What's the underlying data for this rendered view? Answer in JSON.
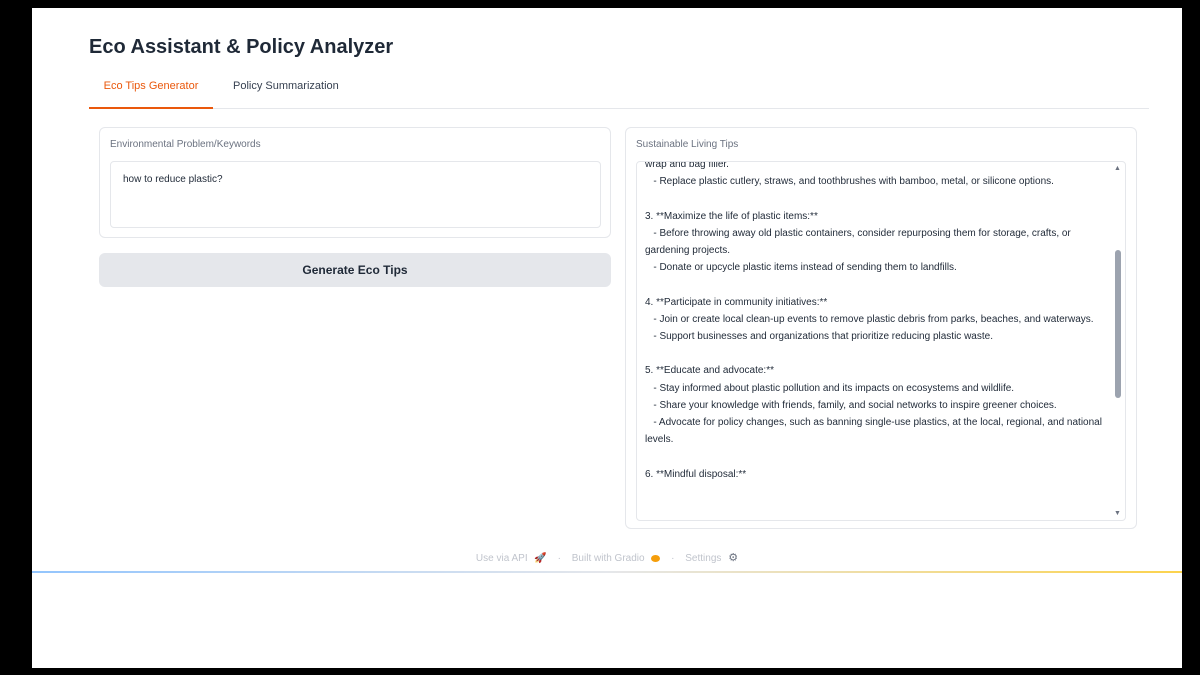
{
  "app": {
    "title": "Eco Assistant & Policy Analyzer"
  },
  "tabs": [
    {
      "label": "Eco Tips Generator",
      "active": true
    },
    {
      "label": "Policy Summarization",
      "active": false
    }
  ],
  "input_panel": {
    "label": "Environmental Problem/Keywords",
    "value": "how to reduce plastic?"
  },
  "generate_button": {
    "label": "Generate Eco Tips"
  },
  "output_panel": {
    "label": "Sustainable Living Tips",
    "text": "wrap and bag filler.\n   - Replace plastic cutlery, straws, and toothbrushes with bamboo, metal, or silicone options.\n\n3. **Maximize the life of plastic items:**\n   - Before throwing away old plastic containers, consider repurposing them for storage, crafts, or gardening projects.\n   - Donate or upcycle plastic items instead of sending them to landfills.\n\n4. **Participate in community initiatives:**\n   - Join or create local clean-up events to remove plastic debris from parks, beaches, and waterways.\n   - Support businesses and organizations that prioritize reducing plastic waste.\n\n5. **Educate and advocate:**\n   - Stay informed about plastic pollution and its impacts on ecosystems and wildlife.\n   - Share your knowledge with friends, family, and social networks to inspire greener choices.\n   - Advocate for policy changes, such as banning single-use plastics, at the local, regional, and national levels.\n\n6. **Mindful disposal:**"
  },
  "footer": {
    "api_label": "Use via API",
    "api_icon": "rocket-icon",
    "separator": "·",
    "built_label": "Built with Gradio",
    "gradio_icon": "gradio-logo-icon",
    "settings_label": "Settings",
    "settings_icon": "gear-icon"
  },
  "colors": {
    "accent": "#ea580c",
    "button_bg": "#e5e7eb",
    "text": "#1f2937"
  }
}
